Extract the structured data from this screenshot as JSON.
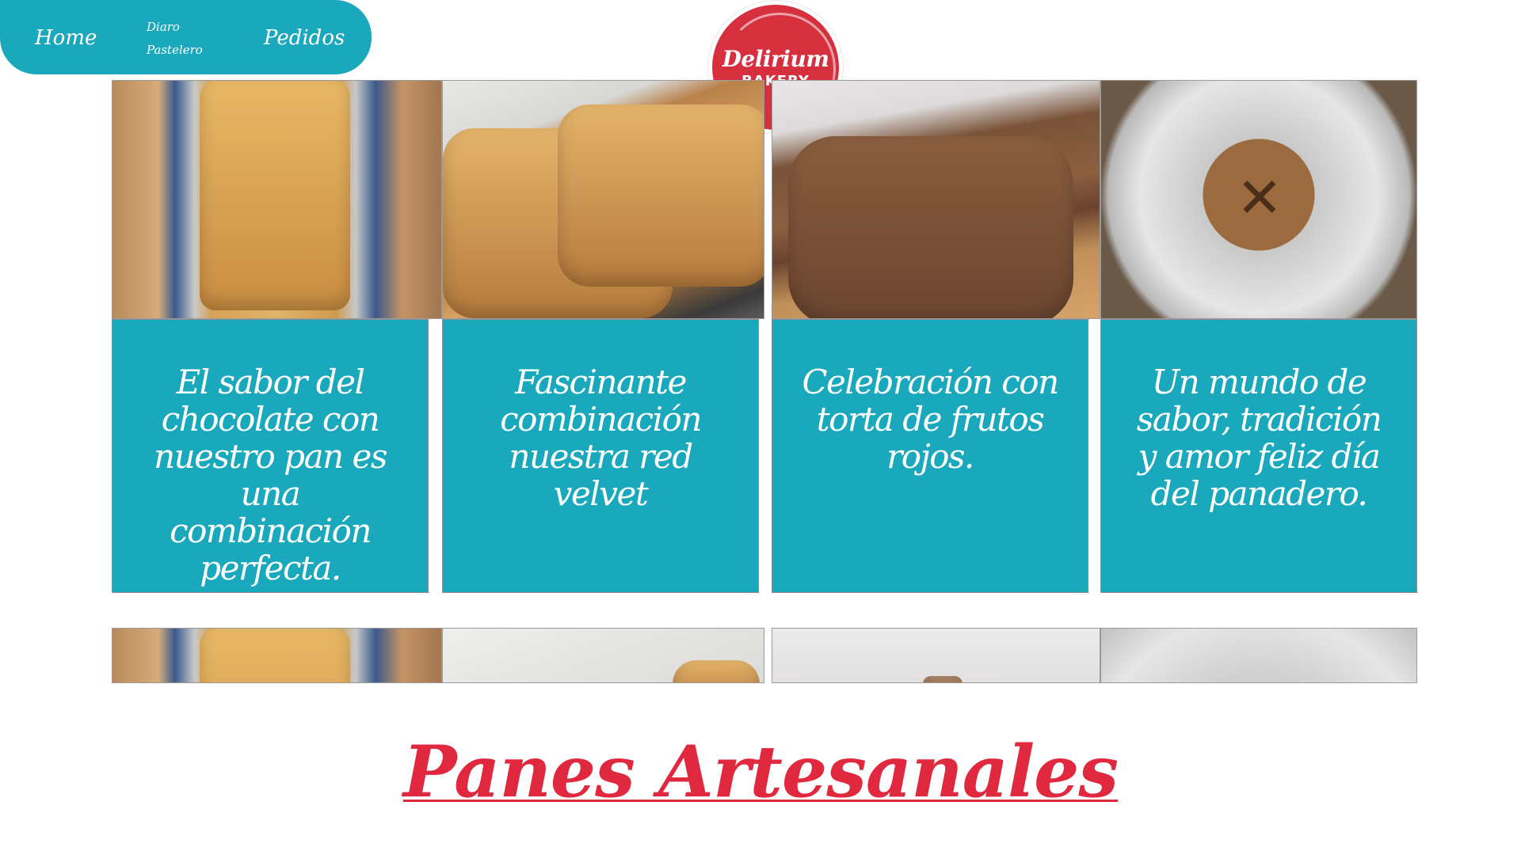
{
  "nav": {
    "home": "Home",
    "diario": "Diaro Pastelero",
    "pedidos": "Pedidos"
  },
  "logo": {
    "line1": "Delirium",
    "line2": "BAKERY"
  },
  "cards": [
    {
      "text": "El sabor del chocolate con nuestro pan es una combinación perfecta."
    },
    {
      "text": "Fascinante combinación nuestra red velvet"
    },
    {
      "text": "Celebración con torta de frutos rojos."
    },
    {
      "text": "Un mundo de sabor, tradición y amor feliz día del panadero."
    }
  ],
  "heading": "Panes Artesanales",
  "colors": {
    "teal": "#1aa9bc",
    "brand_red": "#d6303e",
    "heading_red": "#e0283f"
  }
}
